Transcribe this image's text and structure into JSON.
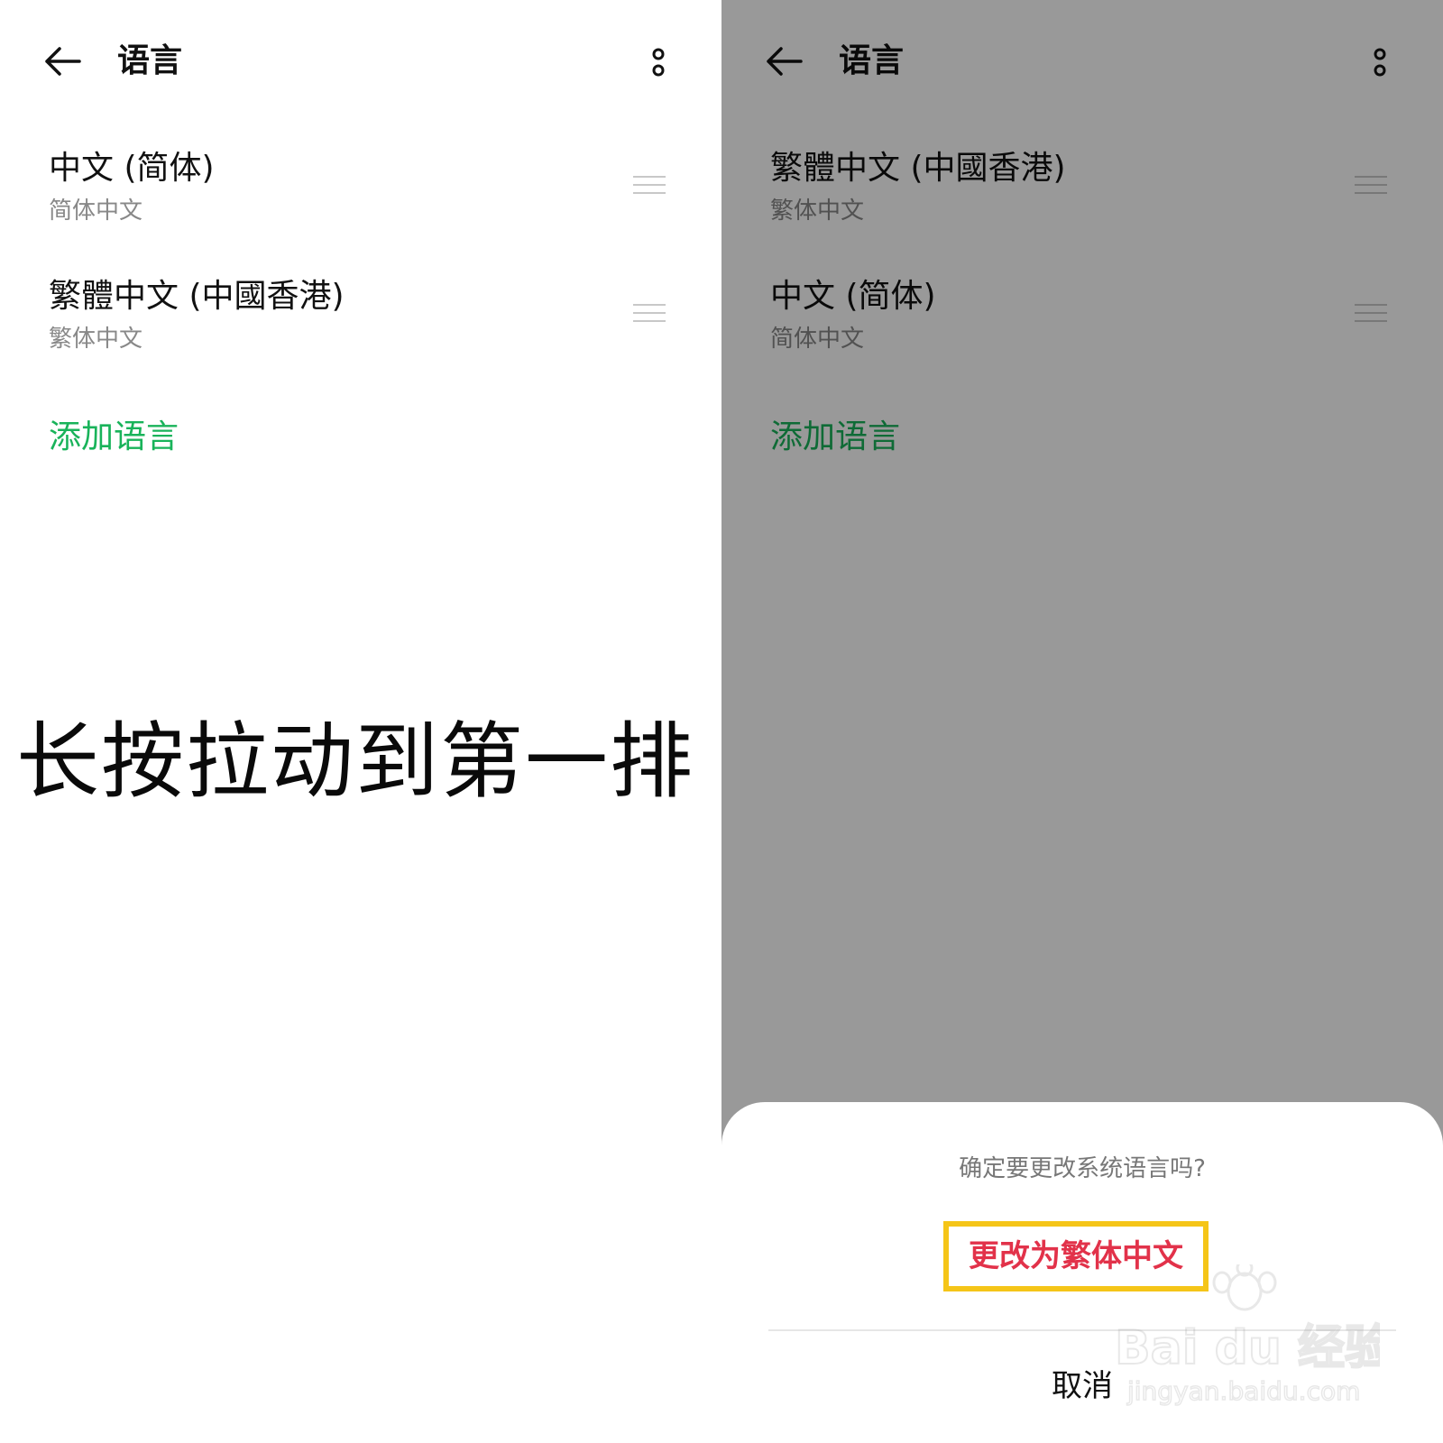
{
  "header": {
    "title": "语言"
  },
  "left": {
    "languages": [
      {
        "name": "中文 (简体)",
        "subtitle": "简体中文"
      },
      {
        "name": "繁體中文 (中國香港)",
        "subtitle": "繁体中文"
      }
    ],
    "add_language": "添加语言",
    "caption": "长按拉动到第一排"
  },
  "right": {
    "languages": [
      {
        "name": "繁體中文 (中國香港)",
        "subtitle": "繁体中文"
      },
      {
        "name": "中文 (简体)",
        "subtitle": "简体中文"
      }
    ],
    "add_language": "添加语言",
    "dialog": {
      "prompt": "确定要更改系统语言吗?",
      "confirm": "更改为繁体中文",
      "cancel": "取消"
    },
    "watermark": {
      "brand": "Bai du 经验",
      "url": "jingyan.baidu.com"
    }
  },
  "colors": {
    "accent": "#19b35a",
    "confirm_text": "#e2324a",
    "highlight": "#f5c518",
    "overlay": "#999999"
  }
}
